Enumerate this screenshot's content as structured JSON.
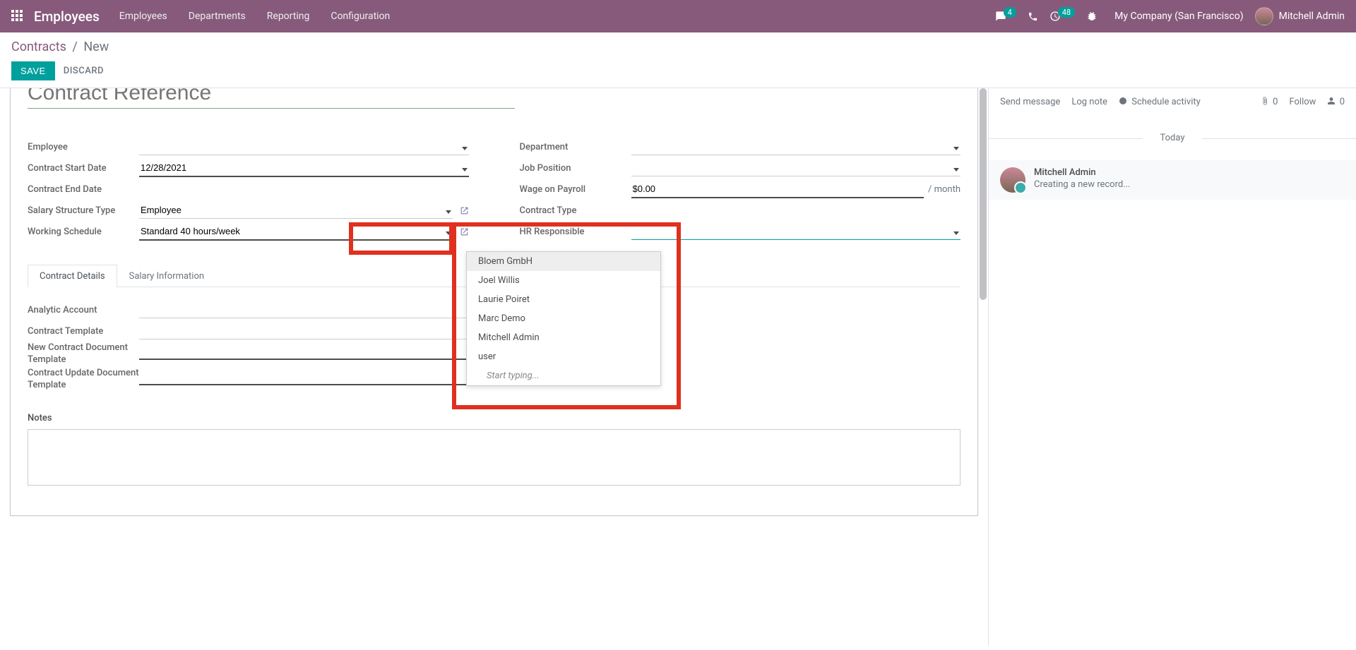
{
  "nav": {
    "brand": "Employees",
    "items": [
      "Employees",
      "Departments",
      "Reporting",
      "Configuration"
    ],
    "badge_msgs": "4",
    "badge_activities": "48",
    "company": "My Company (San Francisco)",
    "user": "Mitchell Admin"
  },
  "breadcrumb": {
    "root": "Contracts",
    "current": "New"
  },
  "buttons": {
    "save": "SAVE",
    "discard": "DISCARD"
  },
  "title_placeholder": "Contract Reference",
  "left_fields": {
    "employee": {
      "label": "Employee",
      "value": ""
    },
    "start": {
      "label": "Contract Start Date",
      "value": "12/28/2021"
    },
    "end": {
      "label": "Contract End Date",
      "value": ""
    },
    "salary_struct": {
      "label": "Salary Structure Type",
      "value": "Employee"
    },
    "schedule": {
      "label": "Working Schedule",
      "value": "Standard 40 hours/week"
    }
  },
  "right_fields": {
    "department": {
      "label": "Department",
      "value": ""
    },
    "job": {
      "label": "Job Position",
      "value": ""
    },
    "wage": {
      "label": "Wage on Payroll",
      "value": "$0.00",
      "unit": "/ month"
    },
    "ctype": {
      "label": "Contract Type",
      "value": ""
    },
    "hr": {
      "label": "HR Responsible",
      "value": ""
    }
  },
  "tabs": {
    "t1": "Contract Details",
    "t2": "Salary Information"
  },
  "details": {
    "analytic": {
      "label": "Analytic Account",
      "value": ""
    },
    "template": {
      "label": "Contract Template",
      "value": ""
    },
    "newdoc": {
      "label": "New Contract Document Template",
      "value": ""
    },
    "updatedoc": {
      "label": "Contract Update Document Template",
      "value": ""
    },
    "notes_label": "Notes"
  },
  "dropdown": {
    "options": [
      "Bloem GmbH",
      "Joel Willis",
      "Laurie Poiret",
      "Marc Demo",
      "Mitchell Admin",
      "user"
    ],
    "hint": "Start typing..."
  },
  "chatter": {
    "send": "Send message",
    "log": "Log note",
    "schedule": "Schedule activity",
    "attach_count": "0",
    "follow": "Follow",
    "followers": "0",
    "today": "Today",
    "msg_author": "Mitchell Admin",
    "msg_text": "Creating a new record..."
  }
}
